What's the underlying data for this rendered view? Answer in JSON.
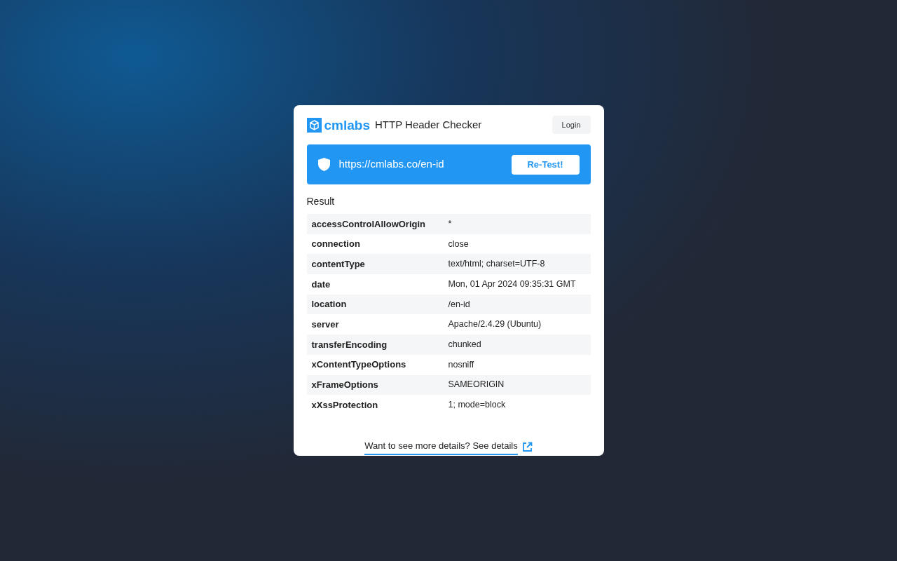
{
  "header": {
    "brand": "cmlabs",
    "title": "HTTP Header Checker",
    "login": "Login"
  },
  "test_bar": {
    "url": "https://cmlabs.co/en-id",
    "button": "Re-Test!"
  },
  "result": {
    "title": "Result",
    "rows": [
      {
        "name": "accessControlAllowOrigin",
        "value": "*"
      },
      {
        "name": "connection",
        "value": "close"
      },
      {
        "name": "contentType",
        "value": "text/html; charset=UTF-8"
      },
      {
        "name": "date",
        "value": "Mon, 01 Apr 2024 09:35:31 GMT"
      },
      {
        "name": "location",
        "value": "/en-id"
      },
      {
        "name": "server",
        "value": "Apache/2.4.29 (Ubuntu)"
      },
      {
        "name": "transferEncoding",
        "value": "chunked"
      },
      {
        "name": "xContentTypeOptions",
        "value": "nosniff"
      },
      {
        "name": "xFrameOptions",
        "value": "SAMEORIGIN"
      },
      {
        "name": "xXssProtection",
        "value": "1; mode=block"
      }
    ]
  },
  "footer_link": "Want to see more details? See details"
}
